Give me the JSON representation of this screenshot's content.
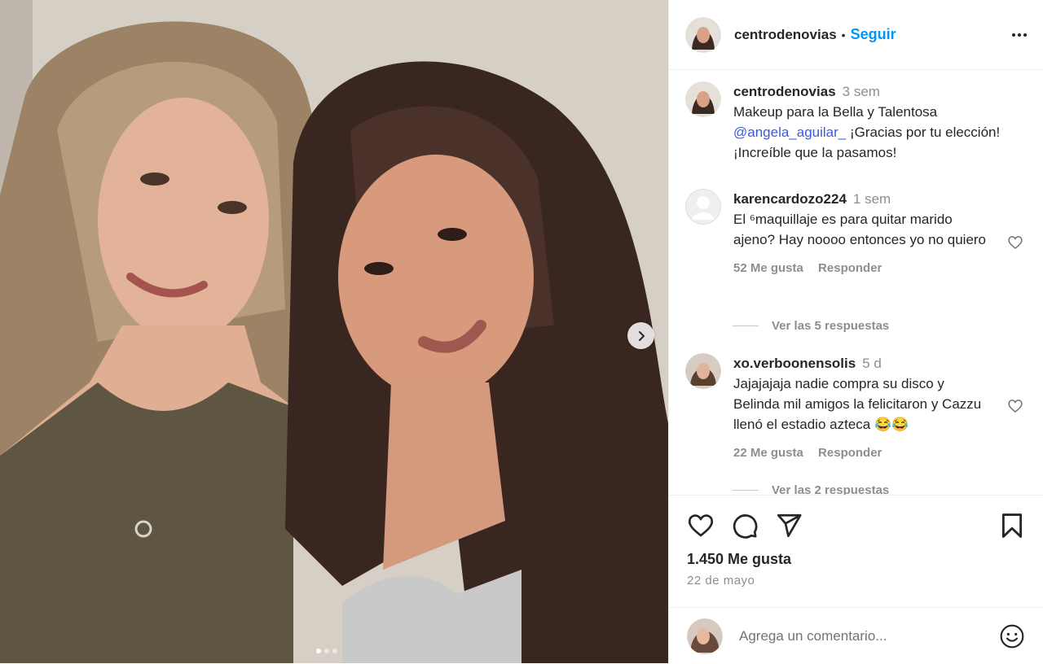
{
  "post": {
    "username": "centrodenovias",
    "follow_label": "Seguir",
    "separator": "•",
    "photo_alt": "Two women posing together",
    "carousel_count": 3,
    "carousel_active": 1
  },
  "caption": {
    "username": "centrodenovias",
    "time": "3 sem",
    "text_before": "Makeup para la Bella y Talentosa ",
    "mention": "@angela_aguilar_",
    "text_after": " ¡Gracias por tu elección! ¡Increíble que la pasamos!"
  },
  "comments": [
    {
      "username": "karencardozo224",
      "time": "1 sem",
      "text": "El ⁶maquillaje es para quitar marido ajeno? Hay noooo entonces yo no quiero",
      "likes": "52 Me gusta",
      "reply_label": "Responder",
      "view_replies": "Ver las 5 respuestas"
    },
    {
      "username": "xo.verboonensolis",
      "time": "5 d",
      "text": "Jajajajaja nadie compra su disco y Belinda mil amigos la felicitaron y Cazzu llenó el estadio azteca 😂😂",
      "likes": "22 Me gusta",
      "reply_label": "Responder",
      "view_replies": "Ver las 2 respuestas"
    }
  ],
  "actions": {
    "likes": "1.450 Me gusta",
    "date": "22 de mayo"
  },
  "add_comment": {
    "placeholder": "Agrega un comentario..."
  },
  "colors": {
    "link": "#0095f6",
    "text": "#262626",
    "muted": "#8e8e8e",
    "border": "#efefef"
  }
}
